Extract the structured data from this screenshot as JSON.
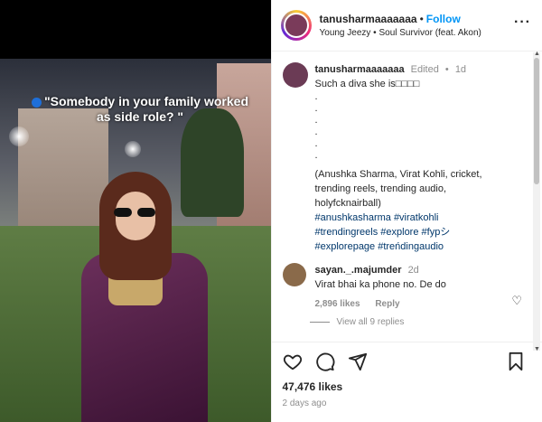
{
  "media": {
    "overlay_text": "\"Somebody in your family worked as side role? \""
  },
  "header": {
    "username": "tanusharmaaaaaaa",
    "separator": "•",
    "follow_label": "Follow",
    "audio": "Young Jeezy • Soul Survivor (feat. Akon)",
    "more_icon": "more-icon"
  },
  "caption": {
    "username": "tanusharmaaaaaaa",
    "edited": "Edited",
    "dot": "•",
    "time": "1d",
    "text": "Such a diva she is□□□□",
    "dots": [
      ".",
      ".",
      ".",
      ".",
      ".",
      "."
    ],
    "keywords": "(Anushka Sharma, Virat Kohli, cricket, trending reels, trending audio, holyfcknairball)",
    "hashtags_line1": "#anushkasharma #viratkohli",
    "hashtags_line2": "#trendingreels #explore #fypシ",
    "hashtags_line3": "#explorepage #treńdingaudio"
  },
  "comments": [
    {
      "username": "sayan._.majumder",
      "time": "2d",
      "text": "Virat bhai ka phone no. De do",
      "likes": "2,896 likes",
      "reply_label": "Reply"
    }
  ],
  "view_all": "View all 9 replies",
  "actions": {
    "likes": "47,476 likes",
    "posted": "2 days ago",
    "icons": [
      "heart-icon",
      "comment-icon",
      "share-icon",
      "bookmark-icon"
    ]
  }
}
